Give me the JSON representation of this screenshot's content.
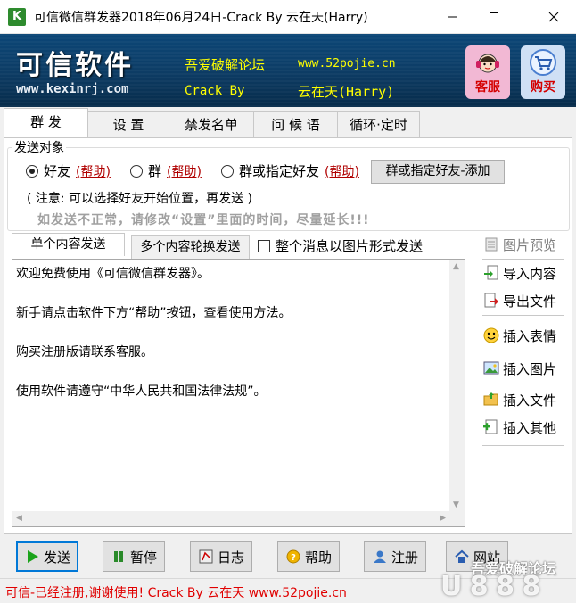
{
  "window": {
    "app_icon_letter": "K",
    "title": "可信微信群发器2018年06月24日-Crack By 云在天(Harry)",
    "controls": [
      "minimize",
      "maximize",
      "close"
    ]
  },
  "banner": {
    "brand_name": "可信软件",
    "brand_url": "www.kexinrj.com",
    "forum_name": "吾爱破解论坛",
    "forum_url": "www.52pojie.cn",
    "crack_label": "Crack By",
    "crack_author": "云在天(Harry)",
    "service_label": "客服",
    "buy_label": "购买"
  },
  "tabs": [
    {
      "label": "群 发",
      "active": true
    },
    {
      "label": "设 置",
      "active": false
    },
    {
      "label": "禁发名单",
      "active": false
    },
    {
      "label": "问 候 语",
      "active": false
    },
    {
      "label": "循环·定时",
      "active": false
    }
  ],
  "send_target": {
    "group_title": "发送对象",
    "options": [
      {
        "label": "好友",
        "help": "(帮助)",
        "checked": true
      },
      {
        "label": "群",
        "help": "(帮助)",
        "checked": false
      },
      {
        "label": "群或指定好友",
        "help": "(帮助)",
        "checked": false
      }
    ],
    "add_button": "群或指定好友-添加",
    "note": "( 注意: 可以选择好友开始位置，再发送 )",
    "warning": "如发送不正常，请修改“设置”里面的时间，尽量延长!!!"
  },
  "content_tabs": [
    {
      "label": "单个内容发送",
      "active": true
    },
    {
      "label": "多个内容轮换发送",
      "active": false
    }
  ],
  "image_checkbox": {
    "label": "整个消息以图片形式发送",
    "checked": false
  },
  "editor": {
    "lines": [
      "欢迎免费使用《可信微信群发器》。",
      "新手请点击软件下方“帮助”按钮，查看使用方法。",
      "购买注册版请联系客服。",
      "使用软件请遵守“中华人民共和国法律法规”。"
    ]
  },
  "side_tools": {
    "preview": "图片预览",
    "import": "导入内容",
    "export": "导出文件",
    "emoji": "插入表情",
    "image": "插入图片",
    "file": "插入文件",
    "other": "插入其他"
  },
  "bottom_buttons": {
    "send": "发送",
    "pause": "暂停",
    "log": "日志",
    "help": "帮助",
    "register": "注册",
    "website": "网站"
  },
  "status": {
    "text": "可信-已经注册,谢谢使用! Crack By 云在天 www.52pojie.cn"
  },
  "watermark": {
    "text": "吾爱破解论坛",
    "big": "U 8 8 8"
  },
  "colors": {
    "banner_bg": "#0d3d66",
    "banner_accent": "#ffff00",
    "status_text": "#e00000",
    "help_link": "#b00000",
    "focus_border": "#0078d7"
  }
}
